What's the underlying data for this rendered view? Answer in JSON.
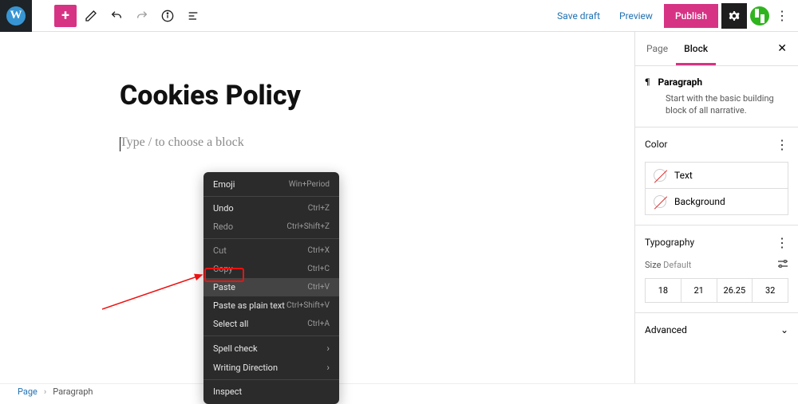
{
  "toolbar": {
    "save_draft": "Save draft",
    "preview": "Preview",
    "publish": "Publish"
  },
  "editor": {
    "title": "Cookies Policy",
    "placeholder": "Type / to choose a block"
  },
  "context_menu": {
    "emoji": "Emoji",
    "emoji_sc": "Win+Period",
    "undo": "Undo",
    "undo_sc": "Ctrl+Z",
    "redo": "Redo",
    "redo_sc": "Ctrl+Shift+Z",
    "cut": "Cut",
    "cut_sc": "Ctrl+X",
    "copy": "Copy",
    "copy_sc": "Ctrl+C",
    "paste": "Paste",
    "paste_sc": "Ctrl+V",
    "paste_plain": "Paste as plain text",
    "paste_plain_sc": "Ctrl+Shift+V",
    "select_all": "Select all",
    "select_all_sc": "Ctrl+A",
    "spell": "Spell check",
    "writing": "Writing Direction",
    "inspect": "Inspect"
  },
  "sidebar": {
    "tab_page": "Page",
    "tab_block": "Block",
    "block_name": "Paragraph",
    "block_desc": "Start with the basic building block of all narrative.",
    "color_title": "Color",
    "color_text": "Text",
    "color_bg": "Background",
    "typo_title": "Typography",
    "size_label": "Size",
    "size_default": "Default",
    "sizes": [
      "18",
      "21",
      "26.25",
      "32"
    ],
    "advanced": "Advanced"
  },
  "breadcrumb": {
    "root": "Page",
    "current": "Paragraph"
  }
}
